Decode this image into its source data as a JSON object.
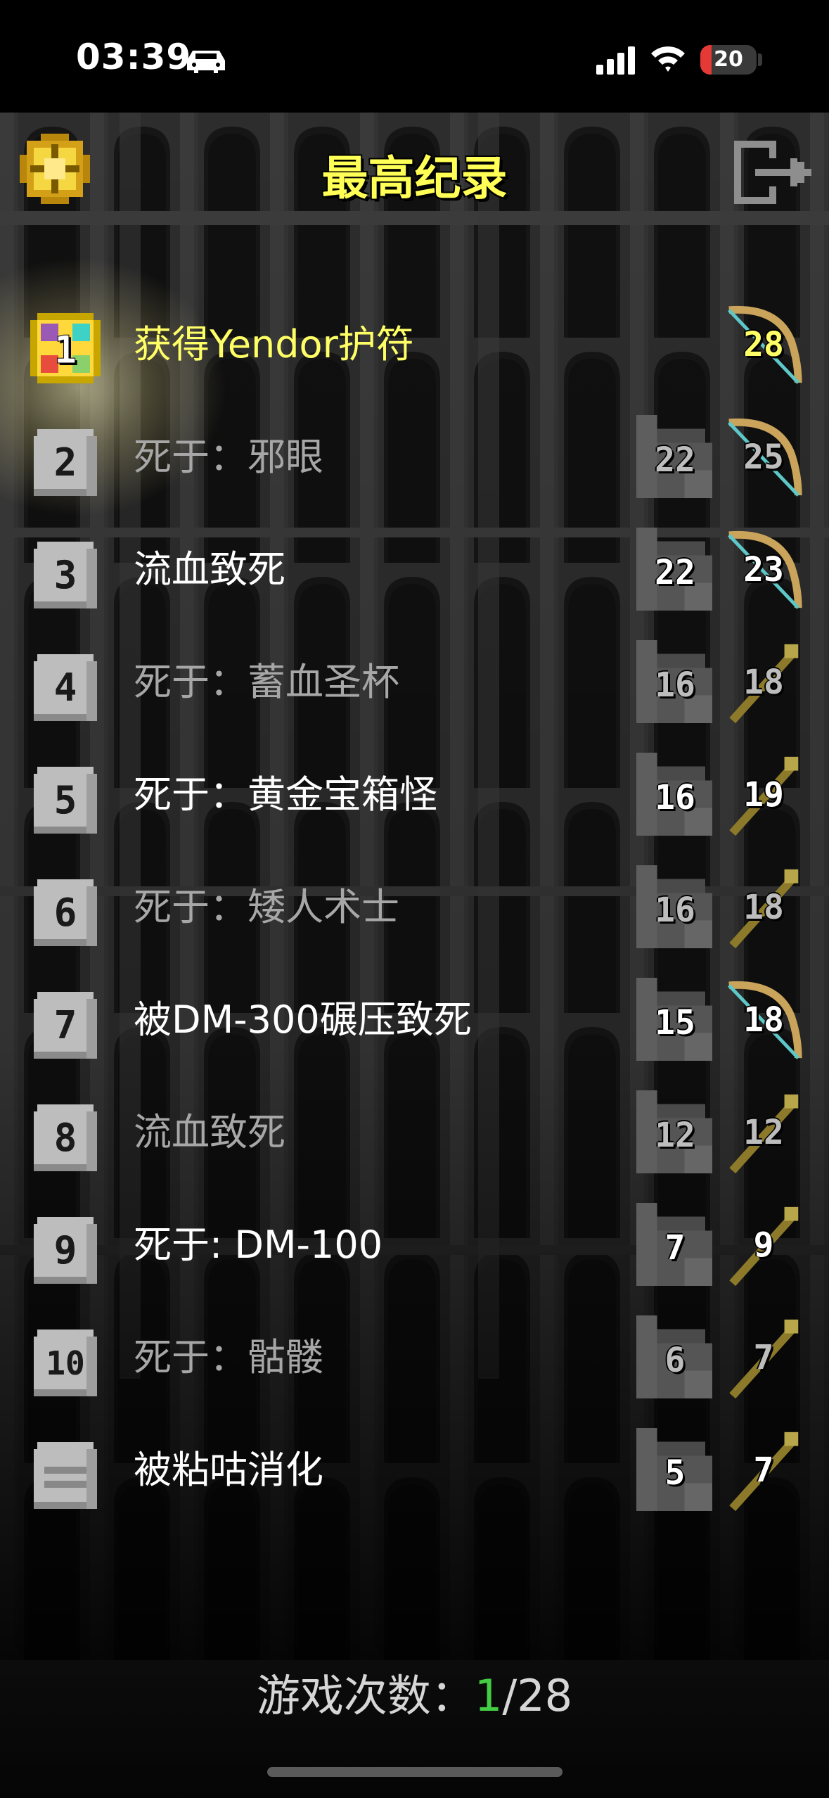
{
  "status_bar": {
    "time": "03:39",
    "battery": "20",
    "battery_level": 0.2,
    "battery_color": "#e53935"
  },
  "header": {
    "title": "最高纪录"
  },
  "records": [
    {
      "rank": "1",
      "label": "获得Yendor护符",
      "depth": "",
      "level": "28",
      "style": "gold",
      "badge": "amulet",
      "weapon": "bow"
    },
    {
      "rank": "2",
      "label": "死于：邪眼",
      "depth": "22",
      "level": "25",
      "style": "dim",
      "badge": "tombstone",
      "weapon": "bow"
    },
    {
      "rank": "3",
      "label": "流血致死",
      "depth": "22",
      "level": "23",
      "style": "bright",
      "badge": "tombstone",
      "weapon": "bow"
    },
    {
      "rank": "4",
      "label": "死于：蓄血圣杯",
      "depth": "16",
      "level": "18",
      "style": "dim",
      "badge": "tombstone",
      "weapon": "staff"
    },
    {
      "rank": "5",
      "label": "死于：黄金宝箱怪",
      "depth": "16",
      "level": "19",
      "style": "bright",
      "badge": "tombstone",
      "weapon": "staff"
    },
    {
      "rank": "6",
      "label": "死于：矮人术士",
      "depth": "16",
      "level": "18",
      "style": "dim",
      "badge": "tombstone",
      "weapon": "staff"
    },
    {
      "rank": "7",
      "label": "被DM-300碾压致死",
      "depth": "15",
      "level": "18",
      "style": "bright",
      "badge": "tombstone",
      "weapon": "bow"
    },
    {
      "rank": "8",
      "label": "流血致死",
      "depth": "12",
      "level": "12",
      "style": "dim",
      "badge": "tombstone",
      "weapon": "staff"
    },
    {
      "rank": "9",
      "label": "死于: DM-100",
      "depth": "7",
      "level": "9",
      "style": "bright",
      "badge": "tombstone",
      "weapon": "staff"
    },
    {
      "rank": "10",
      "label": "死于：骷髅",
      "depth": "6",
      "level": "7",
      "style": "dim",
      "badge": "tombstone",
      "weapon": "staff"
    },
    {
      "rank": "",
      "label": "被粘咕消化",
      "depth": "5",
      "level": "7",
      "style": "bright",
      "badge": "blank-tombstone",
      "weapon": "staff"
    }
  ],
  "footer": {
    "games_label": "游戏次数：",
    "games_won": "1",
    "games_total": "/28"
  },
  "colors": {
    "title": "#ffff55",
    "win_count": "#44cc44",
    "gold_text": "#ffff66"
  }
}
